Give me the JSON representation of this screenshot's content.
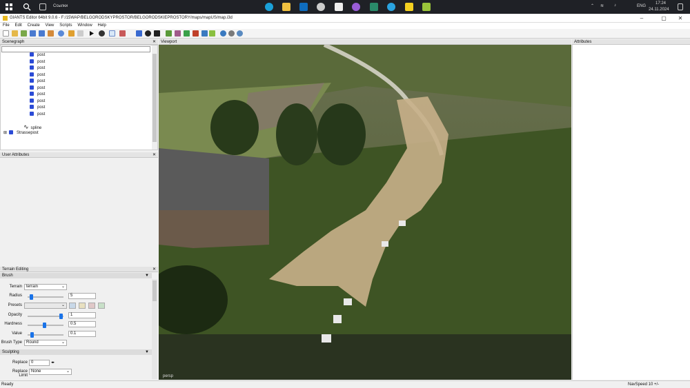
{
  "taskbar": {
    "search_label": "Ссылки",
    "time": "17:24",
    "date": "24.11.2024",
    "lang": "ENG"
  },
  "window": {
    "title": "GIANTS Editor 64bit 9.0.6 - F:/15WAP/BELGORODSKYPROSTOR/BELGORODSKIEPROSTORY/maps/mapUS/map.i3d"
  },
  "menu": [
    "File",
    "Edit",
    "Create",
    "View",
    "Scripts",
    "Window",
    "Help"
  ],
  "scenegraph": {
    "title": "Scenegraph",
    "items": [
      "post",
      "post",
      "post",
      "post",
      "post",
      "post",
      "post",
      "post",
      "post",
      "post",
      "spline",
      "Strassepost"
    ]
  },
  "user_attributes": {
    "title": "User Attributes"
  },
  "viewport": {
    "title": "Viewport",
    "camera_label": "persp"
  },
  "attributes": {
    "title": "Attributes"
  },
  "terrain_editing": {
    "title": "Terrain Editing",
    "brush_section": "Brush",
    "terrain_label": "Terrain",
    "terrain_value": "terrain",
    "radius_label": "Radius",
    "radius_value": "5",
    "radius_level": 0.1,
    "presets_label": "Presets",
    "opacity_label": "Opacity",
    "opacity_value": "1",
    "opacity_level": 1.0,
    "hardness_label": "Hardness",
    "hardness_value": "0.5",
    "hardness_level": 0.5,
    "value_label": "Value",
    "value_value": "0.1",
    "value_level": 0.1,
    "brush_type_label": "Brush Type",
    "brush_type_value": "Round",
    "sculpting_section": "Sculpting",
    "replace_label": "Replace",
    "replace_value": "0",
    "replace_limit_label": "Replace Limit",
    "replace_limit_value": "None"
  },
  "status": {
    "left": "Ready",
    "right": "NavSpeed 10 +/-"
  }
}
